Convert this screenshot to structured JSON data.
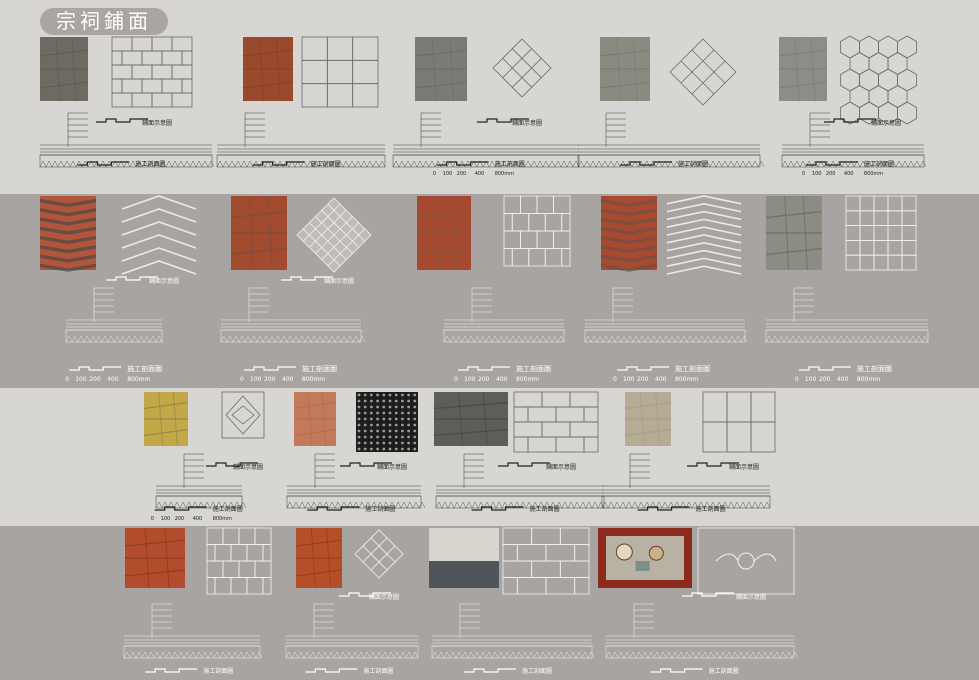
{
  "title": "宗祠鋪面",
  "labels": {
    "plan": "鋪面示意圖",
    "section": "施工剖面圖",
    "scale_0": "0",
    "scale_100": "100",
    "scale_200": "200",
    "scale_400": "400",
    "scale_800": "800mm"
  },
  "colors": {
    "band_light": "#d8d6d3",
    "band_dark": "#a8a4a1",
    "title_pill": "#aaa5a0"
  },
  "rows": [
    {
      "name": "row-1",
      "tiles": [
        {
          "photo": "gray-stone",
          "pattern": "running-bond",
          "label": "plan"
        },
        {
          "photo": "red-terrazzo",
          "pattern": "grid-3x3",
          "label": "none"
        },
        {
          "photo": "gray-stone-fine",
          "pattern": "diamond",
          "label": "plan"
        },
        {
          "photo": "gray-stone-diagonal",
          "pattern": "diamond",
          "label": "none"
        },
        {
          "photo": "gray-hex",
          "pattern": "hexagon",
          "label": "plan"
        }
      ]
    },
    {
      "name": "row-2",
      "tiles": [
        {
          "photo": "red-herringbone",
          "pattern": "herringbone",
          "label": "plan"
        },
        {
          "photo": "red-square-diamond",
          "pattern": "diamond-grid",
          "label": "plan"
        },
        {
          "photo": "red-basketweave",
          "pattern": "brick-grid",
          "label": "none"
        },
        {
          "photo": "red-herringbone-fine",
          "pattern": "herringbone-fine",
          "label": "none"
        },
        {
          "photo": "gray-grass-paver",
          "pattern": "grid-small",
          "label": "none"
        }
      ]
    },
    {
      "name": "row-3",
      "tiles": [
        {
          "photo": "yellow-green-marble",
          "pattern": "long-diamond",
          "label": "plan"
        },
        {
          "photo": "red-tile-light",
          "pattern": "dark-lattice",
          "label": "plan"
        },
        {
          "photo": "dark-slate",
          "pattern": "running-bond-long",
          "label": "plan"
        },
        {
          "photo": "beige-stone",
          "pattern": "grid-2x3",
          "label": "plan"
        }
      ]
    },
    {
      "name": "row-4",
      "tiles": [
        {
          "photo": "red-clay-tile",
          "pattern": "staggered",
          "label": "none"
        },
        {
          "photo": "red-clay-diagonal",
          "pattern": "diamond",
          "label": "plan"
        },
        {
          "photo": "white-gray-stone",
          "pattern": "running-bond-long",
          "label": "none"
        },
        {
          "photo": "pebble-flower-mosaic",
          "pattern": "flower-mosaic",
          "label": "plan"
        }
      ]
    }
  ]
}
